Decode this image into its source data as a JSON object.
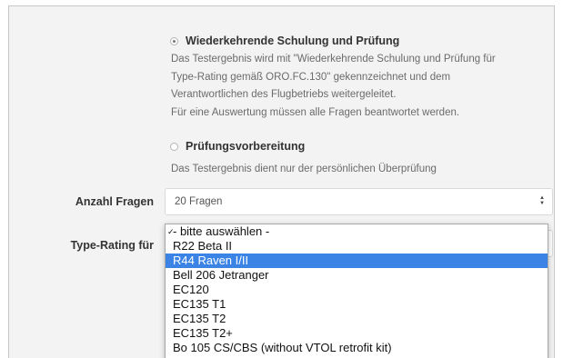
{
  "exam_type": {
    "option_recurring": {
      "label": "Wiederkehrende Schulung und Prüfung",
      "checked": true,
      "description": [
        "Das Testergebnis wird mit \"Wiederkehrende Schulung und Prüfung für",
        "Type-Rating gemäß ORO.FC.130\" gekennzeichnet und dem",
        "Verantwortlichen des Flugbetriebs weitergeleitet.",
        "Für eine Auswertung müssen alle Fragen beantwortet werden."
      ]
    },
    "option_prep": {
      "label": "Prüfungsvorbereitung",
      "checked": false,
      "description": "Das Testergebnis dient nur der persönlichen Überprüfung"
    }
  },
  "anzahl_fragen": {
    "label": "Anzahl Fragen",
    "value": "20 Fragen"
  },
  "type_rating": {
    "label": "Type-Rating für",
    "options": [
      "- bitte auswählen -",
      "R22 Beta II",
      "R44 Raven I/II",
      "Bell 206 Jetranger",
      "EC120",
      "EC135 T1",
      "EC135 T2",
      "EC135 T2+",
      "Bo 105 CS/CBS (without VTOL retrofit kit)"
    ],
    "checkmark": "✓",
    "checked_index": 0,
    "highlighted_index": 2
  },
  "colors": {
    "highlight": "#3b84e6",
    "page_bg": "#f3f3f3"
  }
}
